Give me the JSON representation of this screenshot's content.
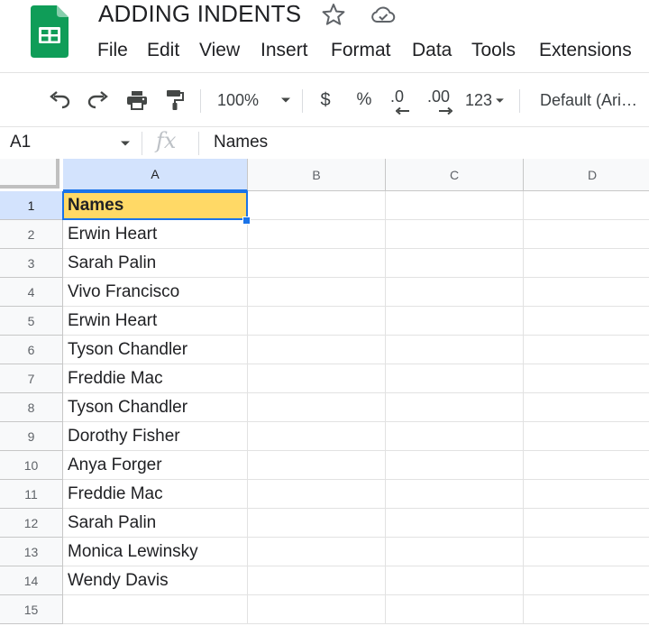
{
  "document": {
    "title": "ADDING INDENTS"
  },
  "menu": [
    "File",
    "Edit",
    "View",
    "Insert",
    "Format",
    "Data",
    "Tools",
    "Extensions"
  ],
  "toolbar": {
    "zoom": "100%",
    "currency_symbol": "$",
    "percent_symbol": "%",
    "decrease_decimal": ".0",
    "increase_decimal": ".00",
    "number_format": "123",
    "font_name": "Default (Ari…"
  },
  "formula_bar": {
    "cell_ref": "A1",
    "fx_symbol": "fx",
    "value": "Names"
  },
  "columns": [
    "A",
    "B",
    "C",
    "D"
  ],
  "rows": [
    "1",
    "2",
    "3",
    "4",
    "5",
    "6",
    "7",
    "8",
    "9",
    "10",
    "11",
    "12",
    "13",
    "14",
    "15"
  ],
  "cells_a": [
    "Names",
    "Erwin Heart",
    "Sarah Palin",
    "Vivo Francisco",
    "Erwin Heart",
    "Tyson Chandler",
    "Freddie Mac",
    "Tyson Chandler",
    "Dorothy Fisher",
    "Anya Forger",
    "Freddie Mac",
    "Sarah Palin",
    "Monica Lewinsky",
    "Wendy Davis",
    ""
  ],
  "colors": {
    "header_fill": "#ffd966",
    "selection": "#1a73e8",
    "brand_green": "#0f9d58"
  },
  "icons": [
    "sheets-logo-icon",
    "star-icon",
    "cloud-done-icon",
    "undo-icon",
    "redo-icon",
    "print-icon",
    "paint-format-icon",
    "chevron-down-icon"
  ]
}
